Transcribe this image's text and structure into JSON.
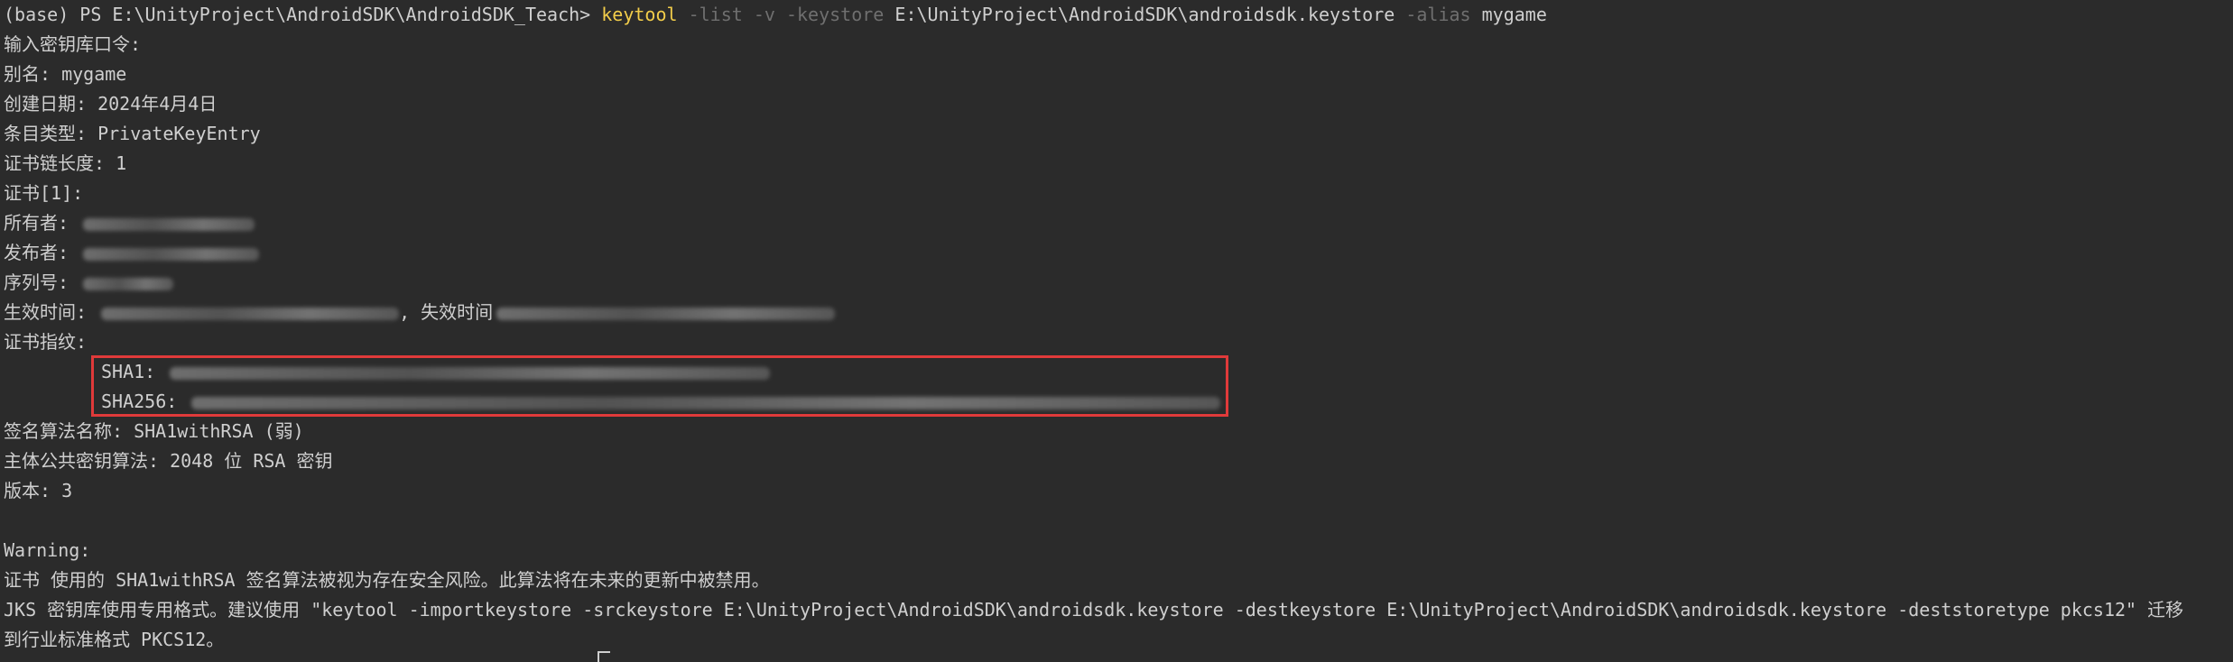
{
  "prompt": {
    "prefix": "(base) PS E:\\UnityProject\\AndroidSDK\\AndroidSDK_Teach> ",
    "command": "keytool",
    "flag_list": " -list",
    "flag_v": " -v",
    "flag_keystore": " -keystore",
    "keystore_path": " E:\\UnityProject\\AndroidSDK\\androidsdk.keystore",
    "flag_alias": " -alias",
    "alias_value": " mygame"
  },
  "output": {
    "enter_password": "输入密钥库口令:",
    "alias": "别名: mygame",
    "created": "创建日期: 2024年4月4日",
    "entry_type": "条目类型: PrivateKeyEntry",
    "chain_length": "证书链长度: 1",
    "cert_index": "证书[1]:",
    "owner_label": "所有者: ",
    "issuer_label": "发布者: ",
    "serial_label": "序列号: ",
    "valid_from_label": "生效时间: ",
    "valid_until_label": ", 失效时间",
    "fingerprints_label": "证书指纹:",
    "sha1_label": "SHA1: ",
    "sha256_label": "SHA256: ",
    "sig_alg": "签名算法名称: SHA1withRSA (弱)",
    "pubkey_alg": "主体公共密钥算法: 2048 位 RSA 密钥",
    "version": "版本: 3",
    "warning_title": "Warning:",
    "warning_1": "证书 使用的 SHA1withRSA 签名算法被视为存在安全风险。此算法将在未来的更新中被禁用。",
    "warning_2": "JKS 密钥库使用专用格式。建议使用 \"keytool -importkeystore -srckeystore E:\\UnityProject\\AndroidSDK\\androidsdk.keystore -destkeystore E:\\UnityProject\\AndroidSDK\\androidsdk.keystore -deststoretype pkcs12\" 迁移",
    "warning_3": "到行业标准格式 PKCS12。"
  },
  "colors": {
    "background": "#2b2b2b",
    "text": "#cfcfcf",
    "command": "#f2cd4a",
    "flag": "#6f6f6f",
    "highlight_border": "#e03a3a"
  }
}
